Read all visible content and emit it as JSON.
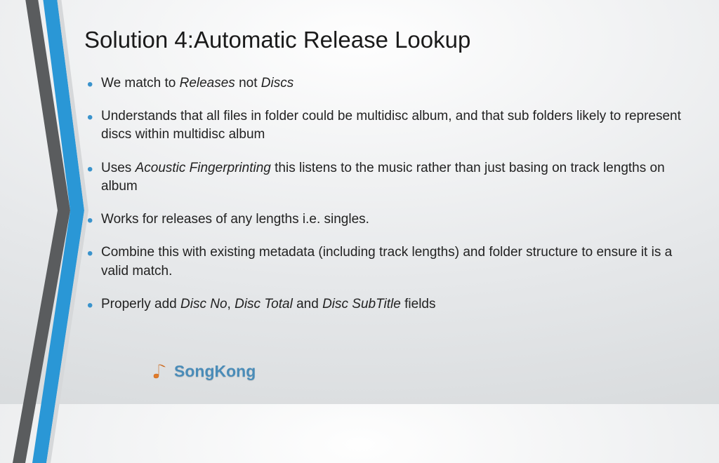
{
  "title": "Solution 4:Automatic Release Lookup",
  "bullets": {
    "b0": {
      "t0": "We match to ",
      "i0": "Releases",
      "t1": " not ",
      "i1": "Discs"
    },
    "b1": {
      "t0": "Understands that all files in folder could be multidisc album, and that sub folders likely to represent discs within multidisc album"
    },
    "b2": {
      "t0": "Uses ",
      "i0": "Acoustic Fingerprinting",
      "t1": "  this listens to the music rather than just basing on track lengths on album"
    },
    "b3": {
      "t0": "Works for releases of any lengths i.e. singles."
    },
    "b4": {
      "t0": "Combine this with existing metadata (including track lengths) and folder structure to ensure it is a valid match."
    },
    "b5": {
      "t0": "Properly add ",
      "i0": "Disc No",
      "t1": ", ",
      "i1": "Disc Total",
      "t2": " and ",
      "i2": "Disc SubTitle",
      "t3": " fields"
    }
  },
  "brand": {
    "name": "SongKong"
  },
  "colors": {
    "accent": "#3a93cc",
    "ribbonDark": "#5a5c5e",
    "ribbonBlue": "#2a97d6"
  }
}
